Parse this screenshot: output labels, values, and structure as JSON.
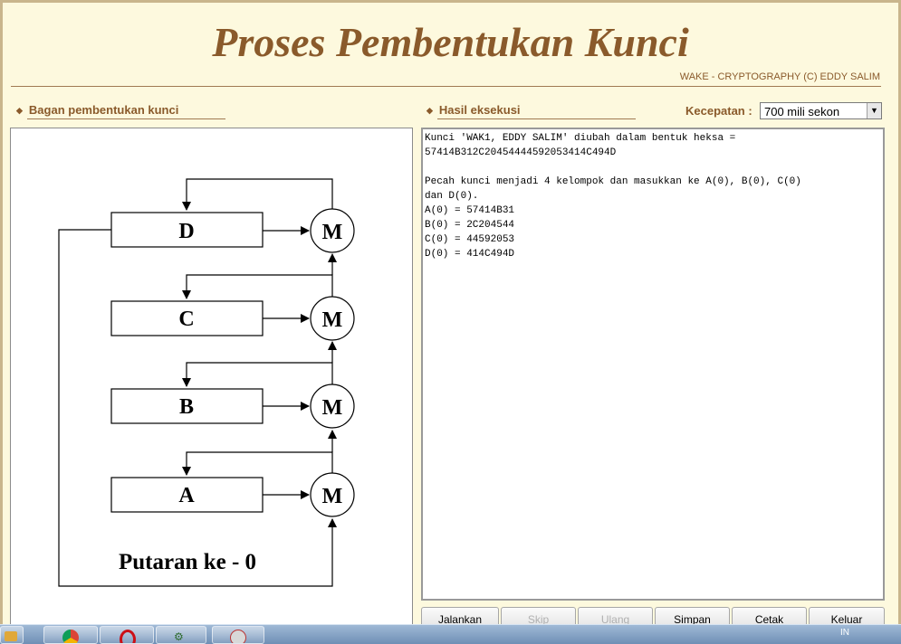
{
  "app": {
    "title": "Proses Pembentukan Kunci",
    "credit": "WAKE - CRYPTOGRAPHY (C) EDDY SALIM"
  },
  "left_panel": {
    "heading": "Bagan pembentukan kunci"
  },
  "right_panel": {
    "heading": "Hasil eksekusi",
    "speed_label": "Kecepatan :",
    "speed_value": "700 mili sekon"
  },
  "diagram": {
    "registers": [
      "D",
      "C",
      "B",
      "A"
    ],
    "mixer_label": "M",
    "round_label": "Putaran ke - 0"
  },
  "output": {
    "text": "Kunci 'WAK1, EDDY SALIM' diubah dalam bentuk heksa =\n57414B312C20454444592053414C494D\n\nPecah kunci menjadi 4 kelompok dan masukkan ke A(0), B(0), C(0)\ndan D(0).\nA(0) = 57414B31\nB(0) = 2C204544\nC(0) = 44592053\nD(0) = 414C494D"
  },
  "buttons": {
    "run": "Jalankan",
    "skip": "Skip",
    "repeat": "Ulang",
    "save": "Simpan",
    "print": "Cetak",
    "exit": "Keluar"
  },
  "taskbar": {
    "language": "IN"
  }
}
